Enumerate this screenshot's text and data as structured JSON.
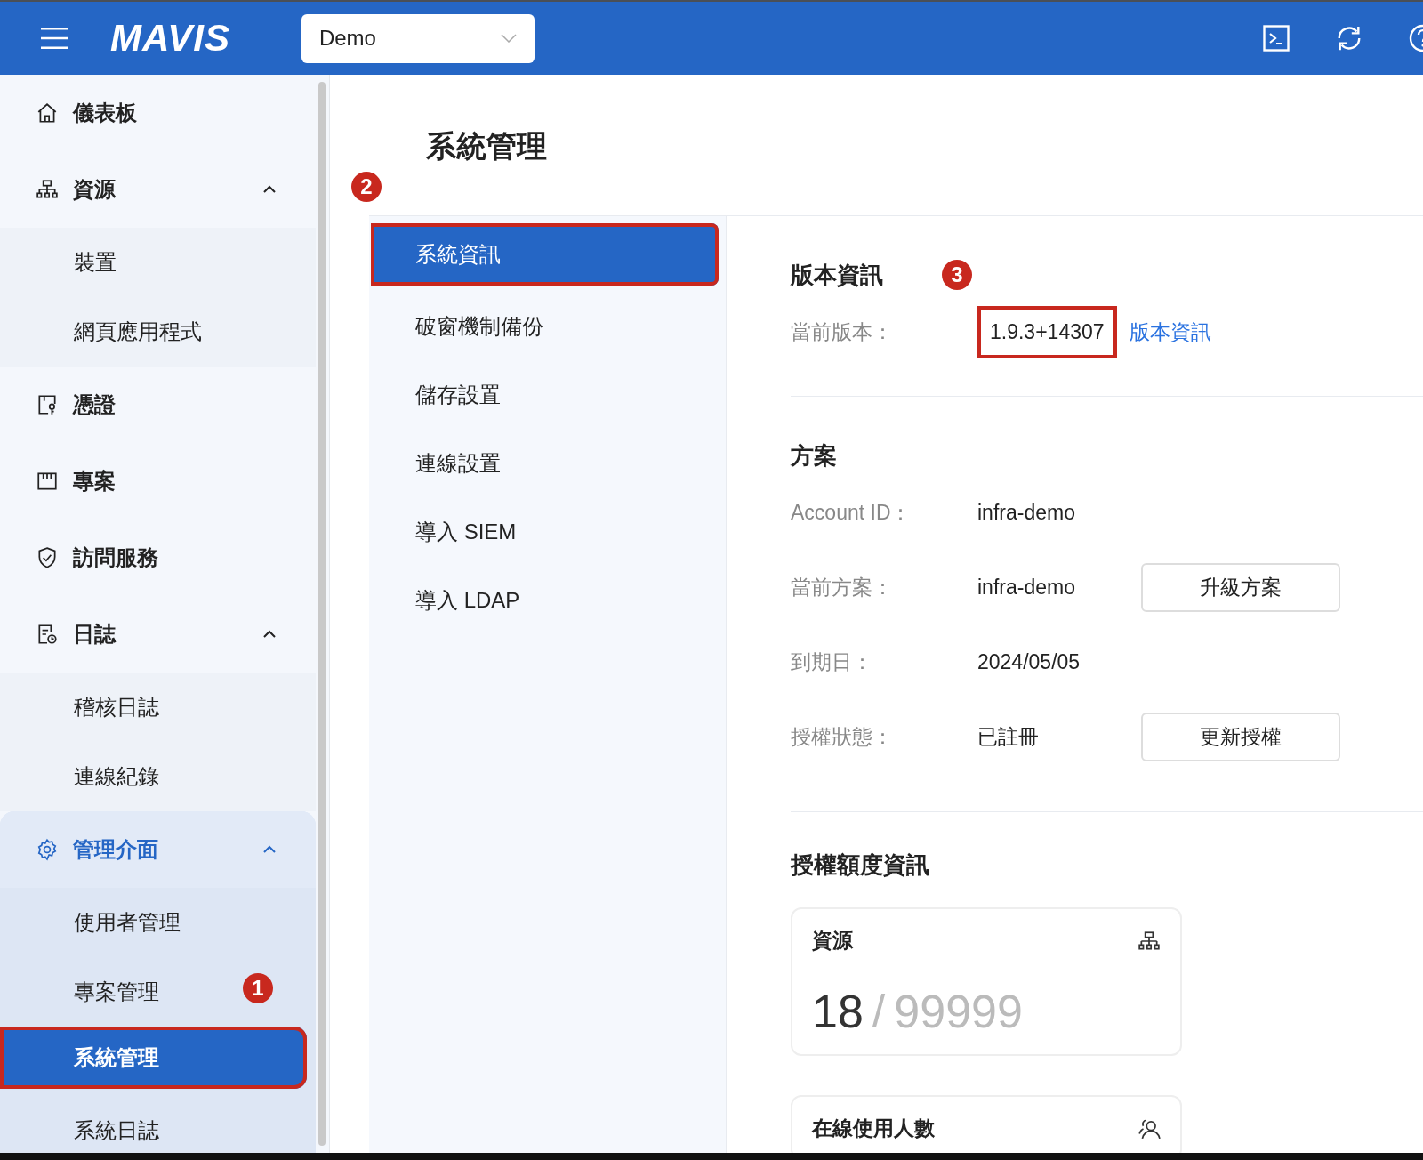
{
  "header": {
    "logo": "MAVIS",
    "project_select": {
      "value": "Demo"
    },
    "tools": [
      {
        "kind": "terminal"
      },
      {
        "kind": "refresh"
      },
      {
        "kind": "help"
      }
    ]
  },
  "sidebar": {
    "items": [
      {
        "kind": "home",
        "label": "儀表板",
        "active": false
      },
      {
        "kind": "sitemap",
        "label": "資源",
        "active": false,
        "expanded": true,
        "children": [
          {
            "label": "裝置",
            "selected": false,
            "highlighted": false
          },
          {
            "label": "網頁應用程式",
            "selected": false,
            "highlighted": false
          }
        ]
      },
      {
        "kind": "credential",
        "label": "憑證",
        "active": false
      },
      {
        "kind": "board",
        "label": "專案",
        "active": false
      },
      {
        "kind": "shield",
        "label": "訪問服務",
        "active": false
      },
      {
        "kind": "log",
        "label": "日誌",
        "active": false,
        "expanded": true,
        "children": [
          {
            "label": "稽核日誌",
            "selected": false,
            "highlighted": false
          },
          {
            "label": "連線紀錄",
            "selected": false,
            "highlighted": false
          }
        ]
      },
      {
        "kind": "gear",
        "label": "管理介面",
        "active": true,
        "expanded": true,
        "children": [
          {
            "label": "使用者管理",
            "selected": false,
            "highlighted": false
          },
          {
            "label": "專案管理",
            "selected": false,
            "highlighted": false,
            "marker": "1"
          },
          {
            "label": "系統管理",
            "selected": true,
            "highlighted": true
          },
          {
            "label": "系統日誌",
            "selected": false,
            "highlighted": false
          }
        ]
      }
    ]
  },
  "page": {
    "title": "系統管理",
    "subnav": {
      "marker": "2",
      "items": [
        {
          "label": "系統資訊",
          "selected": true,
          "highlighted": true
        },
        {
          "label": "破窗機制備份",
          "selected": false,
          "highlighted": false
        },
        {
          "label": "儲存設置",
          "selected": false,
          "highlighted": false
        },
        {
          "label": "連線設置",
          "selected": false,
          "highlighted": false
        },
        {
          "label": "導入 SIEM",
          "selected": false,
          "highlighted": false
        },
        {
          "label": "導入 LDAP",
          "selected": false,
          "highlighted": false
        }
      ]
    },
    "sections": [
      {
        "heading": "版本資訊",
        "marker": "3",
        "rows": [
          {
            "label": "當前版本：",
            "value": "1.9.3+14307",
            "highlighted": true,
            "link": "版本資訊"
          }
        ]
      },
      {
        "heading": "方案",
        "rows": [
          {
            "label": "Account ID：",
            "value": "infra-demo",
            "highlighted": false
          },
          {
            "label": "當前方案：",
            "value": "infra-demo",
            "highlighted": false,
            "button": "升級方案"
          },
          {
            "label": "到期日：",
            "value": "2024/05/05",
            "highlighted": false
          },
          {
            "label": "授權狀態：",
            "value": "已註冊",
            "highlighted": false,
            "button": "更新授權"
          }
        ]
      }
    ],
    "quota": {
      "heading": "授權額度資訊",
      "cards": [
        {
          "title": "資源",
          "kind": "resources",
          "used": "18",
          "separator": "/",
          "total": "99999"
        },
        {
          "title": "在線使用人數",
          "kind": "online-users"
        }
      ]
    }
  }
}
